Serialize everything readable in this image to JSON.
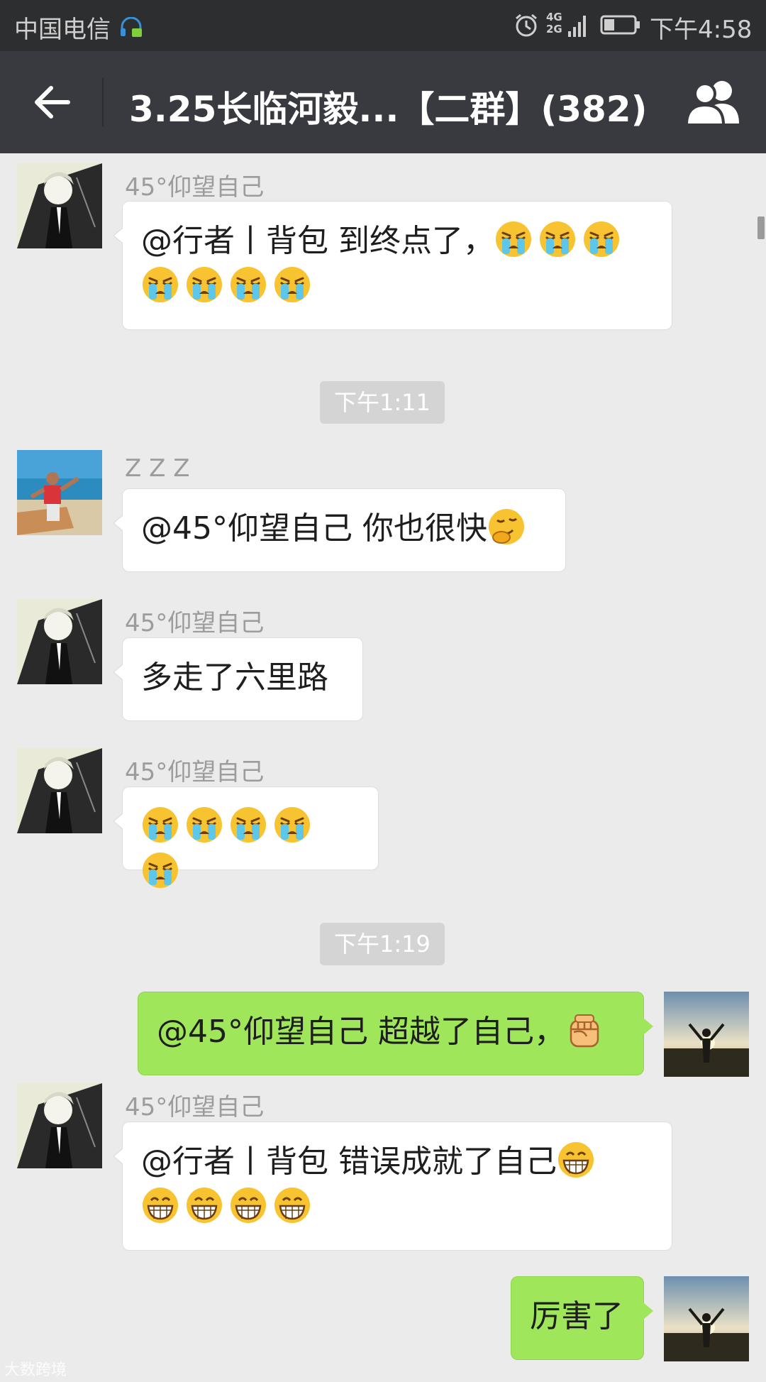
{
  "status_bar": {
    "carrier": "中国电信",
    "network": "4G 2G",
    "time": "下午4:58"
  },
  "header": {
    "title": "3.25长临河毅...【二群】(382)",
    "back_icon": "arrow-left-icon",
    "members_icon": "group-members-icon"
  },
  "messages": [
    {
      "type": "incoming",
      "sender": "45°仰望自己",
      "text": "@行者丨背包 到终点了，",
      "emoji": [
        "crying-face",
        "crying-face",
        "crying-face",
        "crying-face",
        "crying-face",
        "crying-face",
        "crying-face"
      ]
    },
    {
      "type": "timestamp",
      "text": "下午1:11"
    },
    {
      "type": "incoming",
      "sender": "Z Z Z",
      "text": "@45°仰望自己 你也很快",
      "emoji": [
        "giggle-face"
      ]
    },
    {
      "type": "incoming",
      "sender": "45°仰望自己",
      "text": "多走了六里路"
    },
    {
      "type": "incoming",
      "sender": "45°仰望自己",
      "text": "",
      "emoji": [
        "crying-face",
        "crying-face",
        "crying-face",
        "crying-face",
        "crying-face"
      ]
    },
    {
      "type": "timestamp",
      "text": "下午1:19"
    },
    {
      "type": "outgoing",
      "text": "@45°仰望自己 超越了自己，",
      "emoji": [
        "fist"
      ]
    },
    {
      "type": "incoming",
      "sender": "45°仰望自己",
      "text": "@行者丨背包 错误成就了自己",
      "emoji": [
        "grinning-face",
        "grinning-face",
        "grinning-face",
        "grinning-face",
        "grinning-face"
      ]
    },
    {
      "type": "outgoing",
      "text": "厉害了"
    }
  ],
  "watermark": "大数跨境",
  "colors": {
    "status_bar_bg": "#2d2e30",
    "title_bar_bg": "#393a3f",
    "chat_bg": "#ebebeb",
    "outgoing_bubble": "#9fe65a",
    "incoming_bubble": "#ffffff",
    "timestamp_bg": "#d4d4d4"
  }
}
